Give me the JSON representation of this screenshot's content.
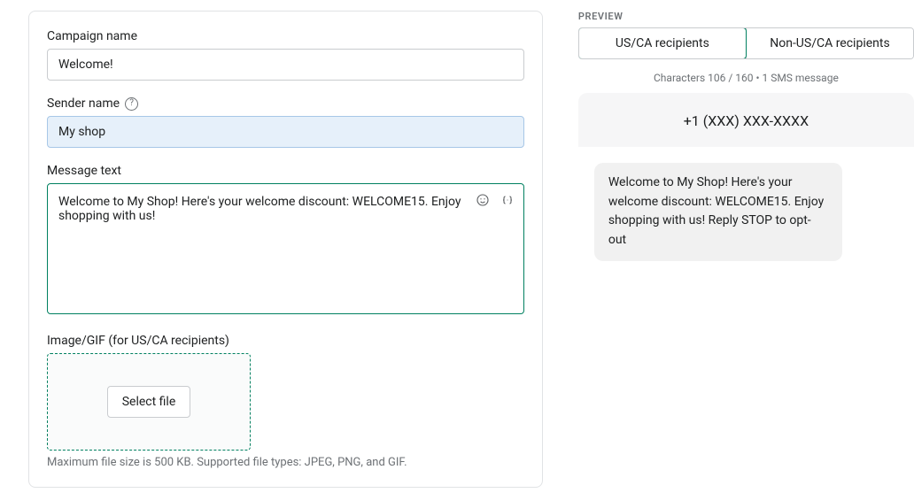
{
  "form": {
    "campaign_name_label": "Campaign name",
    "campaign_name_value": "Welcome!",
    "sender_name_label": "Sender name",
    "sender_name_value": "My shop",
    "message_text_label": "Message text",
    "message_text_value": "Welcome to My Shop! Here's your welcome discount: WELCOME15. Enjoy shopping with us!",
    "image_label": "Image/GIF (for US/CA recipients)",
    "select_file_label": "Select file",
    "file_help_text": "Maximum file size is 500 KB. Supported file types: JPEG, PNG, and GIF."
  },
  "preview": {
    "heading": "PREVIEW",
    "tabs": [
      {
        "label": "US/CA recipients",
        "active": true
      },
      {
        "label": "Non-US/CA recipients",
        "active": false
      }
    ],
    "char_counter": "Characters 106 / 160 • 1 SMS message",
    "phone_number": "+1 (XXX) XXX-XXXX",
    "bubble_text": "Welcome to My Shop! Here's your welcome discount: WELCOME15. Enjoy shopping with us! Reply STOP to opt-out"
  }
}
